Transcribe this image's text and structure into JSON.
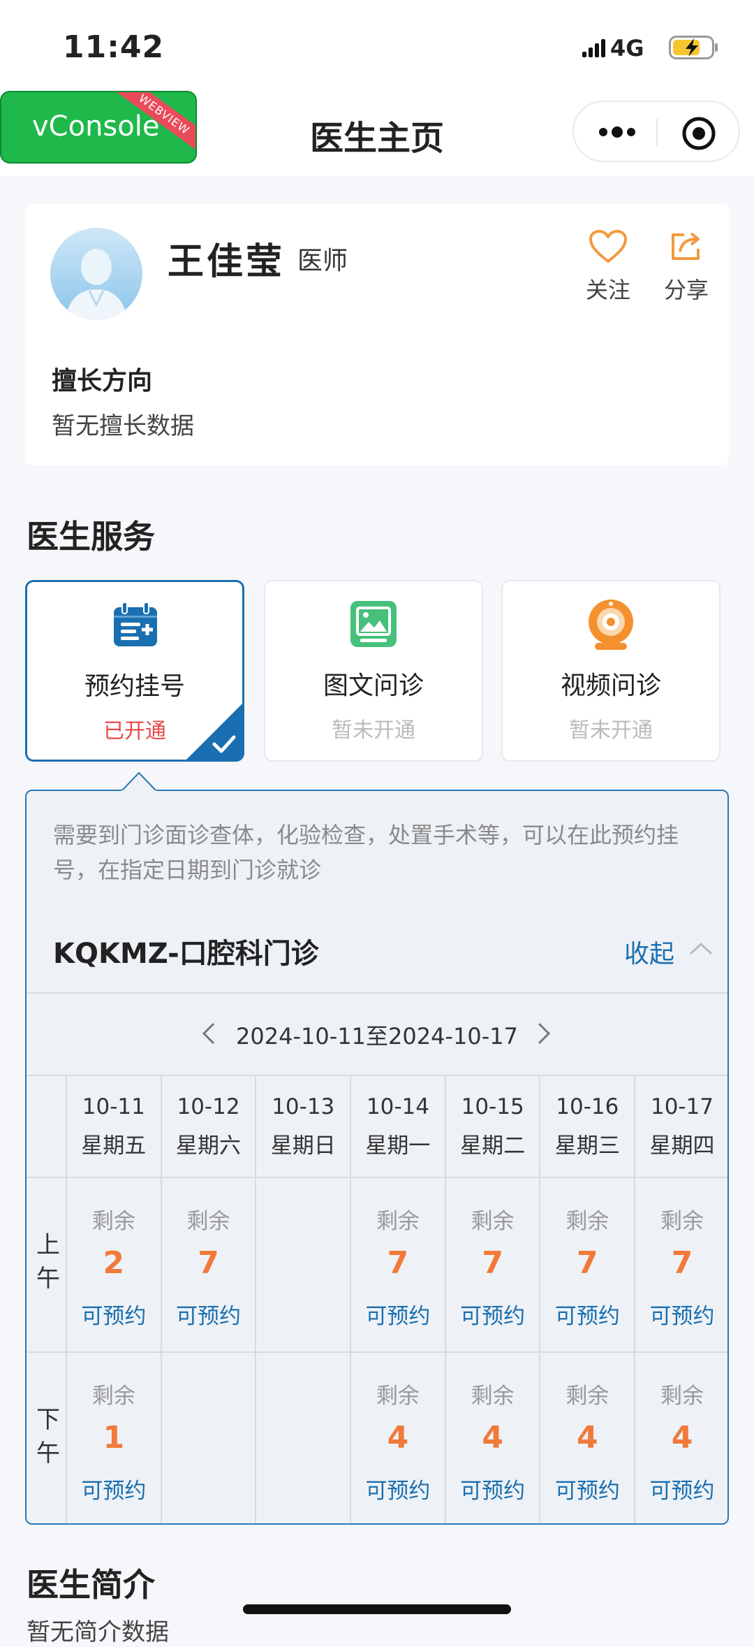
{
  "status_bar": {
    "time": "11:42",
    "network": "4G"
  },
  "nav": {
    "title": "医生主页",
    "vconsole_label": "vConsole",
    "vconsole_badge": "WEBVIEW"
  },
  "doctor": {
    "name": "王佳莹",
    "title": "医师",
    "follow_label": "关注",
    "share_label": "分享",
    "specialty_heading": "擅长方向",
    "specialty_text": "暂无擅长数据"
  },
  "services": {
    "heading": "医生服务",
    "items": [
      {
        "label": "预约挂号",
        "status": "已开通",
        "icon": "calendar-icon"
      },
      {
        "label": "图文问诊",
        "status": "暂未开通",
        "icon": "image-icon"
      },
      {
        "label": "视频问诊",
        "status": "暂未开通",
        "icon": "camera-icon"
      }
    ]
  },
  "schedule": {
    "description": "需要到门诊面诊查体，化验检查，处置手术等，可以在此预约挂号，在指定日期到门诊就诊",
    "department": "KQKMZ-口腔科门诊",
    "collapse_label": "收起",
    "week_range": "2024-10-11至2024-10-17",
    "remaining_label": "剩余",
    "book_label": "可预约",
    "periods": [
      "上午",
      "下午"
    ],
    "days": [
      {
        "date": "10-11",
        "weekday": "星期五",
        "am": "2",
        "pm": "1"
      },
      {
        "date": "10-12",
        "weekday": "星期六",
        "am": "7",
        "pm": ""
      },
      {
        "date": "10-13",
        "weekday": "星期日",
        "am": "",
        "pm": ""
      },
      {
        "date": "10-14",
        "weekday": "星期一",
        "am": "7",
        "pm": "4"
      },
      {
        "date": "10-15",
        "weekday": "星期二",
        "am": "7",
        "pm": "4"
      },
      {
        "date": "10-16",
        "weekday": "星期三",
        "am": "7",
        "pm": "4"
      },
      {
        "date": "10-17",
        "weekday": "星期四",
        "am": "7",
        "pm": "4"
      }
    ]
  },
  "intro": {
    "heading": "医生简介",
    "text": "暂无简介数据"
  },
  "colors": {
    "accent": "#1a6fb0",
    "count": "#f07a3a",
    "active_status": "#e84a4a",
    "vconsole": "#1fb84a"
  }
}
